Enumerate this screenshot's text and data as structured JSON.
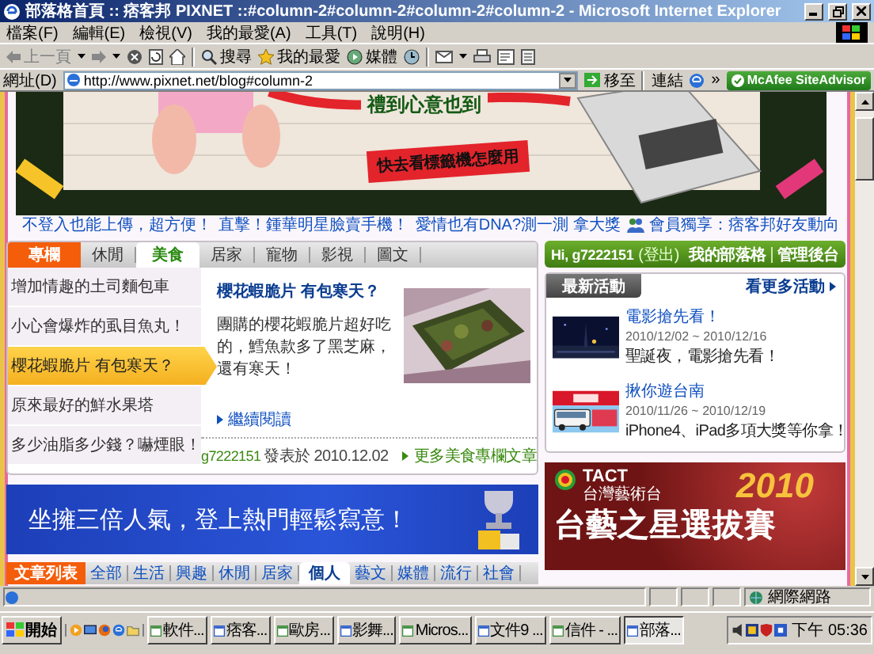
{
  "window": {
    "title": "部落格首頁 :: 痞客邦 PIXNET ::#column-2#column-2#column-2#column-2 - Microsoft Internet Explorer"
  },
  "menu_bar": [
    "檔案(F)",
    "編輯(E)",
    "檢視(V)",
    "我的最愛(A)",
    "工具(T)",
    "說明(H)"
  ],
  "toolbar": {
    "back": "上一頁",
    "search": "搜尋",
    "favorites": "我的最愛",
    "media": "媒體"
  },
  "address_bar": {
    "label": "網址(D)",
    "url": "http://www.pixnet.net/blog#column-2",
    "go": "移至",
    "links": "連結",
    "links_more": "»",
    "addon": "McAfee SiteAdvisor"
  },
  "banner": {
    "headline": "禮到心意也到",
    "sticker": "快去看標籤機怎麼用"
  },
  "promo_links": [
    {
      "text": "不登入也能上傳，超方便！",
      "kind": "plain"
    },
    {
      "text": "直擊！鍾華明星臉賣手機！",
      "kind": "plain"
    },
    {
      "text": "愛情也有DNA?測一測 拿大獎",
      "kind": "plain"
    },
    {
      "text": "會員獨享：痞客邦好友動向",
      "kind": "members"
    }
  ],
  "column_panel": {
    "header": "專欄",
    "tabs": [
      {
        "label": "休閒",
        "selected": false
      },
      {
        "label": "美食",
        "selected": true
      },
      {
        "label": "居家",
        "selected": false
      },
      {
        "label": "寵物",
        "selected": false
      },
      {
        "label": "影視",
        "selected": false
      },
      {
        "label": "圖文",
        "selected": false
      }
    ],
    "list": [
      {
        "title": "增加情趣的土司麵包車",
        "selected": false
      },
      {
        "title": "小心會爆炸的虱目魚丸！",
        "selected": false
      },
      {
        "title": "櫻花蝦脆片 有包寒天？",
        "selected": true
      },
      {
        "title": "原來最好的鮮水果塔",
        "selected": false
      },
      {
        "title": "多少油脂多少錢？嚇煙眼！",
        "selected": false
      }
    ],
    "article": {
      "title": "櫻花蝦脆片 有包寒天？",
      "excerpt": "團購的櫻花蝦脆片超好吃的，鱈魚款多了黑芝麻，還有寒天！",
      "read_more": "繼續閱讀",
      "author": "g7222151",
      "posted": "發表於 2010.12.02",
      "more": "更多美食專欄文章"
    }
  },
  "user_bar": {
    "greeting": "Hi, g7222151",
    "logout": "(登出)",
    "links": [
      "我的部落格",
      "管理後台"
    ]
  },
  "events": {
    "title": "最新活動",
    "more": "看更多活動",
    "items": [
      {
        "title": "電影搶先看！",
        "dates": "2010/12/02 ~ 2010/12/16",
        "desc": "聖誕夜，電影搶先看！",
        "kind": "night"
      },
      {
        "title": "揪你遊台南",
        "dates": "2010/11/26 ~ 2010/12/19",
        "desc": "iPhone4、iPad多項大獎等你拿！",
        "kind": "bus"
      }
    ]
  },
  "ad_banner": {
    "text": "坐擁三倍人氣，登上熱門輕鬆寫意！"
  },
  "side_ad": {
    "brand": "TACT",
    "channel": "台灣藝術台",
    "year": "2010",
    "title": "台藝之星選拔賽"
  },
  "article_tabs": {
    "header": "文章列表",
    "tabs": [
      {
        "label": "全部",
        "selected": false
      },
      {
        "label": "生活",
        "selected": false
      },
      {
        "label": "興趣",
        "selected": false
      },
      {
        "label": "休閒",
        "selected": false
      },
      {
        "label": "居家",
        "selected": false
      },
      {
        "label": "個人",
        "selected": true
      },
      {
        "label": "藝文",
        "selected": false
      },
      {
        "label": "媒體",
        "selected": false
      },
      {
        "label": "流行",
        "selected": false
      },
      {
        "label": "社會",
        "selected": false
      }
    ]
  },
  "status_bar": {
    "zone": "網際網路"
  },
  "taskbar": {
    "start": "開始",
    "tasks": [
      {
        "label": "軟件...",
        "selected": false
      },
      {
        "label": "痞客...",
        "selected": false
      },
      {
        "label": "歐房...",
        "selected": false
      },
      {
        "label": "影舞...",
        "selected": false
      },
      {
        "label": "Micros...",
        "selected": false
      },
      {
        "label": "文件9 ...",
        "selected": false
      },
      {
        "label": "信件 - ...",
        "selected": false
      },
      {
        "label": "部落...",
        "selected": true
      }
    ],
    "clock": "下午 05:36"
  }
}
